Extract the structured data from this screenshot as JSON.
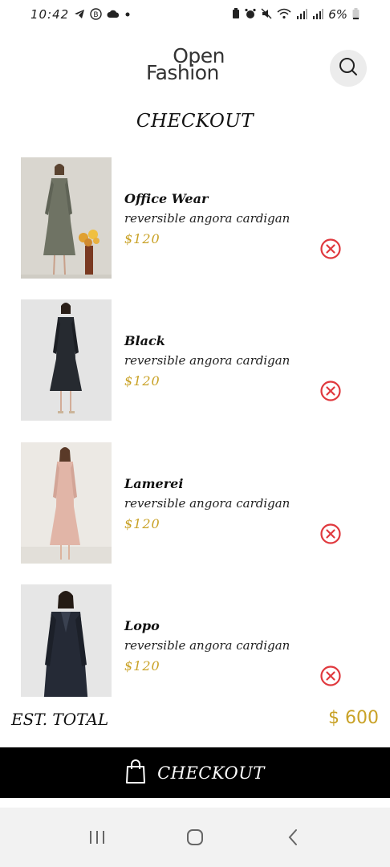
{
  "status_bar": {
    "time": "10:42",
    "battery": "6%",
    "left_icons": [
      "telegram-icon",
      "b-icon",
      "cloud-icon",
      "dot-icon"
    ],
    "right_icons": [
      "battery-saver-icon",
      "alarm-icon",
      "mute-icon",
      "wifi-icon",
      "signal-icon",
      "signal-icon"
    ]
  },
  "header": {
    "logo_line1": "Open",
    "logo_line2": "Fashion",
    "search_icon": "search-icon"
  },
  "page_title": "CHECKOUT",
  "items": [
    {
      "name": "Office Wear",
      "description": "reversible angora cardigan",
      "price": "$120",
      "dress_color": "#6f7364",
      "bg_color": "#d9d6cf"
    },
    {
      "name": "Black",
      "description": "reversible angora cardigan",
      "price": "$120",
      "dress_color": "#262a30",
      "bg_color": "#e4e4e4"
    },
    {
      "name": "Lamerei",
      "description": "reversible angora cardigan",
      "price": "$120",
      "dress_color": "#e1b5a7",
      "bg_color": "#ece9e4"
    },
    {
      "name": "Lopo",
      "description": "reversible angora cardigan",
      "price": "$120",
      "dress_color": "#252a36",
      "bg_color": "#e6e6e6"
    }
  ],
  "total": {
    "label": "EST. TOTAL",
    "value": "$ 600"
  },
  "checkout_button": {
    "label": "CHECKOUT",
    "icon": "shopping-bag-icon"
  },
  "colors": {
    "accent_gold": "#c9a227",
    "remove_red": "#e0393e",
    "bar_black": "#000000"
  },
  "nav": [
    "recents-icon",
    "home-icon",
    "back-icon"
  ]
}
